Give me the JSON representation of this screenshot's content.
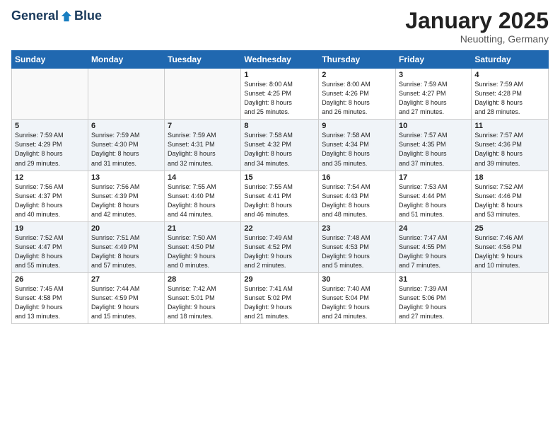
{
  "header": {
    "logo": {
      "general": "General",
      "blue": "Blue"
    },
    "title": "January 2025",
    "subtitle": "Neuotting, Germany"
  },
  "weekdays": [
    "Sunday",
    "Monday",
    "Tuesday",
    "Wednesday",
    "Thursday",
    "Friday",
    "Saturday"
  ],
  "weeks": [
    [
      {
        "day": "",
        "info": ""
      },
      {
        "day": "",
        "info": ""
      },
      {
        "day": "",
        "info": ""
      },
      {
        "day": "1",
        "info": "Sunrise: 8:00 AM\nSunset: 4:25 PM\nDaylight: 8 hours\nand 25 minutes."
      },
      {
        "day": "2",
        "info": "Sunrise: 8:00 AM\nSunset: 4:26 PM\nDaylight: 8 hours\nand 26 minutes."
      },
      {
        "day": "3",
        "info": "Sunrise: 7:59 AM\nSunset: 4:27 PM\nDaylight: 8 hours\nand 27 minutes."
      },
      {
        "day": "4",
        "info": "Sunrise: 7:59 AM\nSunset: 4:28 PM\nDaylight: 8 hours\nand 28 minutes."
      }
    ],
    [
      {
        "day": "5",
        "info": "Sunrise: 7:59 AM\nSunset: 4:29 PM\nDaylight: 8 hours\nand 29 minutes."
      },
      {
        "day": "6",
        "info": "Sunrise: 7:59 AM\nSunset: 4:30 PM\nDaylight: 8 hours\nand 31 minutes."
      },
      {
        "day": "7",
        "info": "Sunrise: 7:59 AM\nSunset: 4:31 PM\nDaylight: 8 hours\nand 32 minutes."
      },
      {
        "day": "8",
        "info": "Sunrise: 7:58 AM\nSunset: 4:32 PM\nDaylight: 8 hours\nand 34 minutes."
      },
      {
        "day": "9",
        "info": "Sunrise: 7:58 AM\nSunset: 4:34 PM\nDaylight: 8 hours\nand 35 minutes."
      },
      {
        "day": "10",
        "info": "Sunrise: 7:57 AM\nSunset: 4:35 PM\nDaylight: 8 hours\nand 37 minutes."
      },
      {
        "day": "11",
        "info": "Sunrise: 7:57 AM\nSunset: 4:36 PM\nDaylight: 8 hours\nand 39 minutes."
      }
    ],
    [
      {
        "day": "12",
        "info": "Sunrise: 7:56 AM\nSunset: 4:37 PM\nDaylight: 8 hours\nand 40 minutes."
      },
      {
        "day": "13",
        "info": "Sunrise: 7:56 AM\nSunset: 4:39 PM\nDaylight: 8 hours\nand 42 minutes."
      },
      {
        "day": "14",
        "info": "Sunrise: 7:55 AM\nSunset: 4:40 PM\nDaylight: 8 hours\nand 44 minutes."
      },
      {
        "day": "15",
        "info": "Sunrise: 7:55 AM\nSunset: 4:41 PM\nDaylight: 8 hours\nand 46 minutes."
      },
      {
        "day": "16",
        "info": "Sunrise: 7:54 AM\nSunset: 4:43 PM\nDaylight: 8 hours\nand 48 minutes."
      },
      {
        "day": "17",
        "info": "Sunrise: 7:53 AM\nSunset: 4:44 PM\nDaylight: 8 hours\nand 51 minutes."
      },
      {
        "day": "18",
        "info": "Sunrise: 7:52 AM\nSunset: 4:46 PM\nDaylight: 8 hours\nand 53 minutes."
      }
    ],
    [
      {
        "day": "19",
        "info": "Sunrise: 7:52 AM\nSunset: 4:47 PM\nDaylight: 8 hours\nand 55 minutes."
      },
      {
        "day": "20",
        "info": "Sunrise: 7:51 AM\nSunset: 4:49 PM\nDaylight: 8 hours\nand 57 minutes."
      },
      {
        "day": "21",
        "info": "Sunrise: 7:50 AM\nSunset: 4:50 PM\nDaylight: 9 hours\nand 0 minutes."
      },
      {
        "day": "22",
        "info": "Sunrise: 7:49 AM\nSunset: 4:52 PM\nDaylight: 9 hours\nand 2 minutes."
      },
      {
        "day": "23",
        "info": "Sunrise: 7:48 AM\nSunset: 4:53 PM\nDaylight: 9 hours\nand 5 minutes."
      },
      {
        "day": "24",
        "info": "Sunrise: 7:47 AM\nSunset: 4:55 PM\nDaylight: 9 hours\nand 7 minutes."
      },
      {
        "day": "25",
        "info": "Sunrise: 7:46 AM\nSunset: 4:56 PM\nDaylight: 9 hours\nand 10 minutes."
      }
    ],
    [
      {
        "day": "26",
        "info": "Sunrise: 7:45 AM\nSunset: 4:58 PM\nDaylight: 9 hours\nand 13 minutes."
      },
      {
        "day": "27",
        "info": "Sunrise: 7:44 AM\nSunset: 4:59 PM\nDaylight: 9 hours\nand 15 minutes."
      },
      {
        "day": "28",
        "info": "Sunrise: 7:42 AM\nSunset: 5:01 PM\nDaylight: 9 hours\nand 18 minutes."
      },
      {
        "day": "29",
        "info": "Sunrise: 7:41 AM\nSunset: 5:02 PM\nDaylight: 9 hours\nand 21 minutes."
      },
      {
        "day": "30",
        "info": "Sunrise: 7:40 AM\nSunset: 5:04 PM\nDaylight: 9 hours\nand 24 minutes."
      },
      {
        "day": "31",
        "info": "Sunrise: 7:39 AM\nSunset: 5:06 PM\nDaylight: 9 hours\nand 27 minutes."
      },
      {
        "day": "",
        "info": ""
      }
    ]
  ]
}
